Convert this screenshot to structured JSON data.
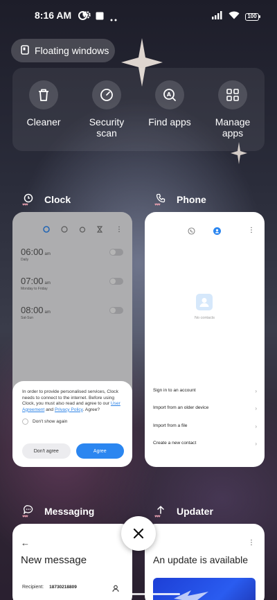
{
  "status_bar": {
    "time": "8:16 AM",
    "battery": "100",
    "icons": [
      "data-saver-icon",
      "gear-icon",
      "app-square-icon",
      "more-dots-icon",
      "signal-icon",
      "wifi-icon",
      "battery-icon"
    ]
  },
  "floating_windows": {
    "label": "Floating windows",
    "icon": "floating-window-icon"
  },
  "quick_actions": [
    {
      "label": "Cleaner",
      "icon": "trash-icon"
    },
    {
      "label": "Security scan",
      "icon": "gauge-icon"
    },
    {
      "label": "Find apps",
      "icon": "find-apps-icon"
    },
    {
      "label": "Manage apps",
      "icon": "grid-icon"
    }
  ],
  "cards": {
    "clock": {
      "title": "Clock",
      "alarms": [
        {
          "time": "06:00",
          "ampm": "am",
          "sub": "Daily"
        },
        {
          "time": "07:00",
          "ampm": "am",
          "sub": "Monday to Friday"
        },
        {
          "time": "08:00",
          "ampm": "am",
          "sub": "Sat-Sun"
        }
      ],
      "dialog": {
        "text_1": "In order to provide personalised services, Clock needs to connect to the internet. Before using Clock, you must also read and agree to our ",
        "link_1": "User Agreement",
        "text_2": " and ",
        "link_2": "Privacy Policy",
        "text_3": ". Agree?",
        "dont_show": "Don't show again",
        "decline": "Don't agree",
        "accept": "Agree"
      }
    },
    "phone": {
      "title": "Phone",
      "empty": "No contacts",
      "options": [
        "Sign in to an account",
        "Import from an older device",
        "Import from a file",
        "Create a new contact"
      ]
    },
    "messaging": {
      "title": "Messaging",
      "heading": "New message",
      "recipient_label": "Recipient:",
      "recipient_value": "18730218809"
    },
    "updater": {
      "title": "Updater",
      "heading": "An update is available"
    }
  },
  "colors": {
    "accent": "#2b86f0",
    "link": "#2b82e6"
  }
}
